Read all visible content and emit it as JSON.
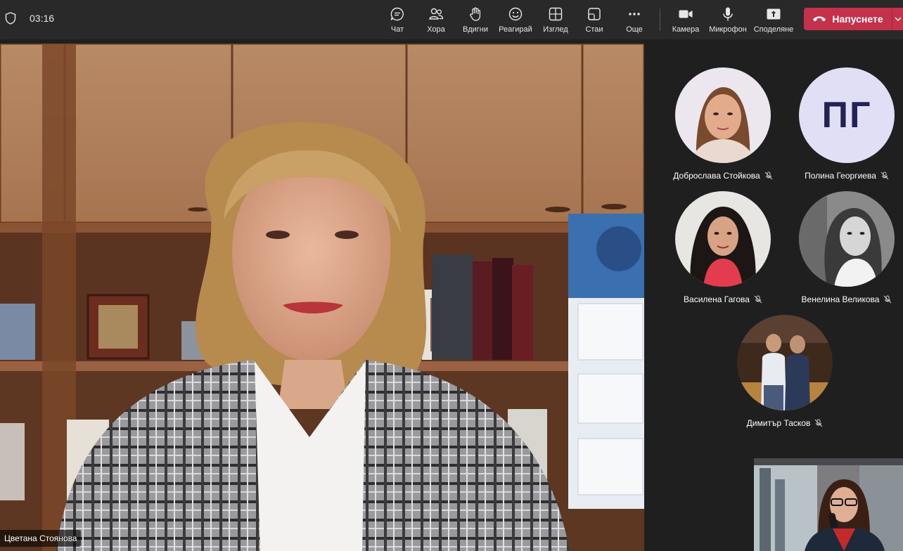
{
  "header": {
    "timer": "03:16",
    "tools": [
      {
        "label": "Чат",
        "icon": "chat-icon"
      },
      {
        "label": "Хора",
        "icon": "people-icon"
      },
      {
        "label": "Вдигни",
        "icon": "raise-hand-icon"
      },
      {
        "label": "Реагирай",
        "icon": "react-icon"
      },
      {
        "label": "Изглед",
        "icon": "view-icon"
      },
      {
        "label": "Стаи",
        "icon": "rooms-icon"
      },
      {
        "label": "Още",
        "icon": "more-icon"
      },
      {
        "label": "Камера",
        "icon": "camera-icon"
      },
      {
        "label": "Микрофон",
        "icon": "microphone-icon"
      },
      {
        "label": "Споделяне",
        "icon": "share-icon"
      }
    ],
    "leave_label": "Напуснете"
  },
  "main_speaker": {
    "name": "Цветана Стоянова"
  },
  "participants": [
    {
      "name": "Доброслава Стойкова",
      "muted": true
    },
    {
      "name": "Полина Георгиева",
      "muted": true,
      "initials": "ПГ"
    },
    {
      "name": "Василена Гагова",
      "muted": true
    },
    {
      "name": "Венелина Великова",
      "muted": true
    },
    {
      "name": "Димитър Тасков",
      "muted": true
    }
  ],
  "colors": {
    "leave": "#c4314b",
    "topbar": "#292929",
    "background": "#1f1f1f"
  }
}
